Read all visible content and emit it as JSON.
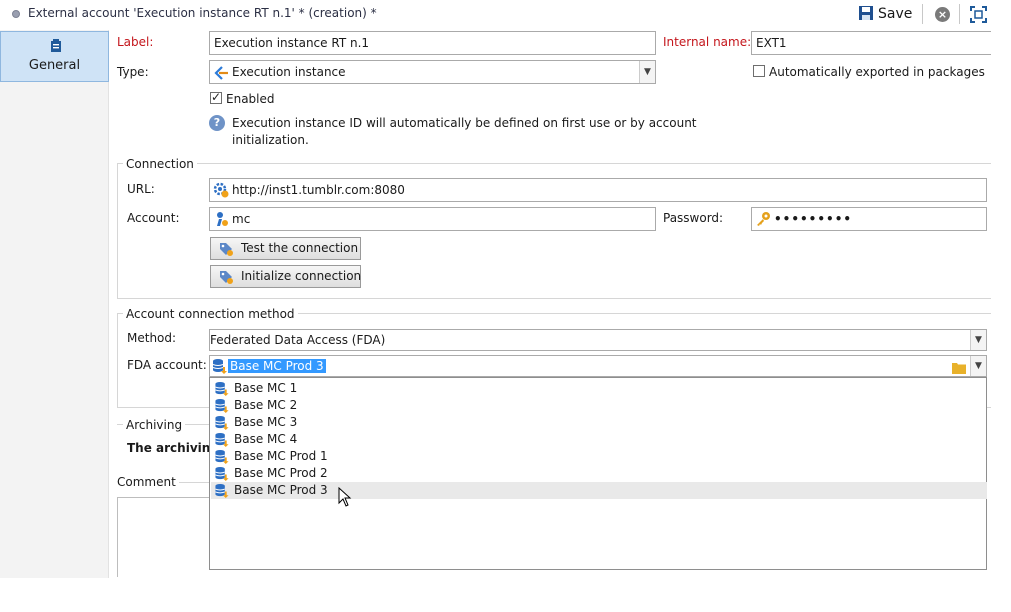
{
  "window": {
    "title": "External account 'Execution instance RT n.1' * (creation) *",
    "save_label": "Save"
  },
  "sidebar": {
    "tabs": [
      {
        "label": "General"
      }
    ]
  },
  "form": {
    "label_caption": "Label:",
    "label_value": "Execution instance RT n.1",
    "internal_name_caption": "Internal name:",
    "internal_name_value": "EXT1",
    "type_caption": "Type:",
    "type_value": "Execution instance",
    "auto_export_label": "Automatically exported in packages",
    "enabled_label": "Enabled",
    "info_text_line1": "Execution instance ID will automatically be defined on first use or by account",
    "info_text_line2": "initialization."
  },
  "connection": {
    "section_title": "Connection",
    "url_caption": "URL:",
    "url_value": "http://inst1.tumblr.com:8080",
    "account_caption": "Account:",
    "account_value": "mc",
    "password_caption": "Password:",
    "password_value": "•••••••••",
    "test_button": "Test the connection",
    "init_button": "Initialize connection"
  },
  "method": {
    "section_title": "Account connection method",
    "method_caption": "Method:",
    "method_value": "Federated Data Access (FDA)",
    "fda_caption": "FDA account:",
    "fda_value": "Base MC Prod 3",
    "options": [
      "Base MC 1",
      "Base MC 2",
      "Base MC 3",
      "Base MC 4",
      "Base MC Prod 1",
      "Base MC Prod 2",
      "Base MC Prod 3"
    ]
  },
  "archiving": {
    "section_title": "Archiving",
    "text": "The archiving"
  },
  "comment": {
    "section_title": "Comment"
  },
  "colors": {
    "required_label": "#c4161c",
    "selection": "#3399ff",
    "tab_active": "#cfe3f6"
  }
}
